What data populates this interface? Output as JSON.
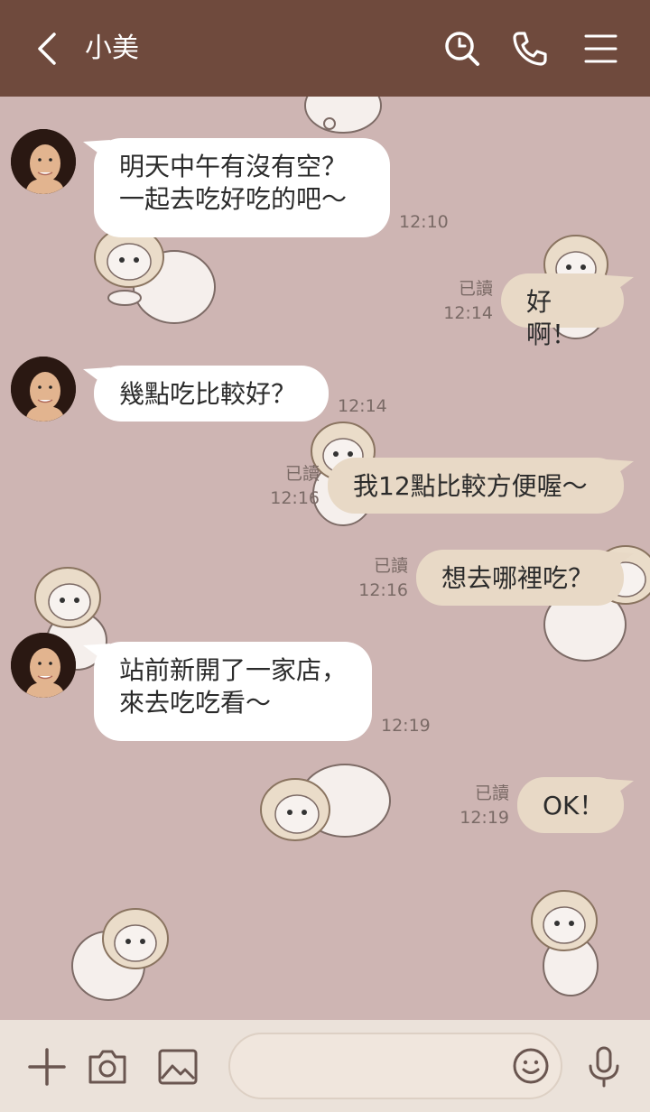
{
  "header": {
    "title": "小美",
    "icons": [
      "back-arrow-icon",
      "search-icon",
      "phone-icon",
      "menu-icon"
    ]
  },
  "colors": {
    "header_bg": "#6F4A3D",
    "chat_bg": "#CEB5B3",
    "incoming_bubble": "#FFFFFF",
    "outgoing_bubble": "#E8D9C6",
    "bottom_bar": "#EBE2DA"
  },
  "messages": [
    {
      "direction": "in",
      "lines": [
        "明天中午有沒有空？",
        "一起去吃好吃的吧～"
      ],
      "time": "12:10"
    },
    {
      "direction": "out",
      "text": "好啊！",
      "read": "已讀",
      "time": "12:14"
    },
    {
      "direction": "in",
      "text": "幾點吃比較好？",
      "time": "12:14"
    },
    {
      "direction": "out",
      "text": "我12點比較方便喔～",
      "read": "已讀",
      "time": "12:16"
    },
    {
      "direction": "out",
      "text": "想去哪裡吃？",
      "read": "已讀",
      "time": "12:16"
    },
    {
      "direction": "in",
      "lines": [
        "站前新開了一家店，",
        "來去吃吃看～"
      ],
      "time": "12:19"
    },
    {
      "direction": "out",
      "text": "OK！",
      "read": "已讀",
      "time": "12:19"
    }
  ],
  "composer": {
    "placeholder": "",
    "icons": [
      "plus-icon",
      "camera-icon",
      "image-icon",
      "emoji-icon",
      "microphone-icon"
    ]
  }
}
